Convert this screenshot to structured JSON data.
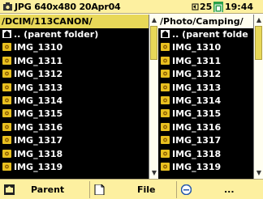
{
  "status": {
    "file_type_icon": "camera-icon",
    "file_info": "JPG 640x480 20Apr04",
    "battery_icon": "battery-icon",
    "battery_value": "25",
    "card_icon": "sd-card-icon",
    "clock": "19:44"
  },
  "left_pane": {
    "path": "/DCIM/113CANON/",
    "rows": [
      {
        "icon": "parent-folder-icon",
        "label": ".. (parent folder)"
      },
      {
        "icon": "image-icon",
        "label": "IMG_1310"
      },
      {
        "icon": "image-icon",
        "label": "IMG_1311"
      },
      {
        "icon": "image-icon",
        "label": "IMG_1312"
      },
      {
        "icon": "image-icon",
        "label": "IMG_1313"
      },
      {
        "icon": "image-icon",
        "label": "IMG_1314"
      },
      {
        "icon": "image-icon",
        "label": "IMG_1315"
      },
      {
        "icon": "image-icon",
        "label": "IMG_1316"
      },
      {
        "icon": "image-icon",
        "label": "IMG_1317"
      },
      {
        "icon": "image-icon",
        "label": "IMG_1318"
      },
      {
        "icon": "image-icon",
        "label": "IMG_1319"
      }
    ]
  },
  "right_pane": {
    "path": "/Photo/Camping/",
    "rows": [
      {
        "icon": "parent-folder-icon",
        "label": ".. (parent folde"
      },
      {
        "icon": "image-icon",
        "label": "IMG_1310"
      },
      {
        "icon": "image-icon",
        "label": "IMG_1311"
      },
      {
        "icon": "image-icon",
        "label": "IMG_1312"
      },
      {
        "icon": "image-icon",
        "label": "IMG_1313"
      },
      {
        "icon": "image-icon",
        "label": "IMG_1314"
      },
      {
        "icon": "image-icon",
        "label": "IMG_1315"
      },
      {
        "icon": "image-icon",
        "label": "IMG_1316"
      },
      {
        "icon": "image-icon",
        "label": "IMG_1317"
      },
      {
        "icon": "image-icon",
        "label": "IMG_1318"
      },
      {
        "icon": "image-icon",
        "label": "IMG_1319"
      }
    ]
  },
  "bottom_bar": {
    "buttons": [
      {
        "icon": "parent-folder-icon",
        "label": "Parent"
      },
      {
        "icon": "file-icon",
        "label": "File"
      },
      {
        "icon": "menu-icon",
        "label": "..."
      }
    ]
  },
  "colors": {
    "status_bar": "#fdf0a0",
    "left_path_highlight": "#e8d858",
    "list_background": "#000000",
    "list_text": "#ffffff",
    "image_icon": "#e8c020",
    "card_icon": "#2aa14a"
  }
}
